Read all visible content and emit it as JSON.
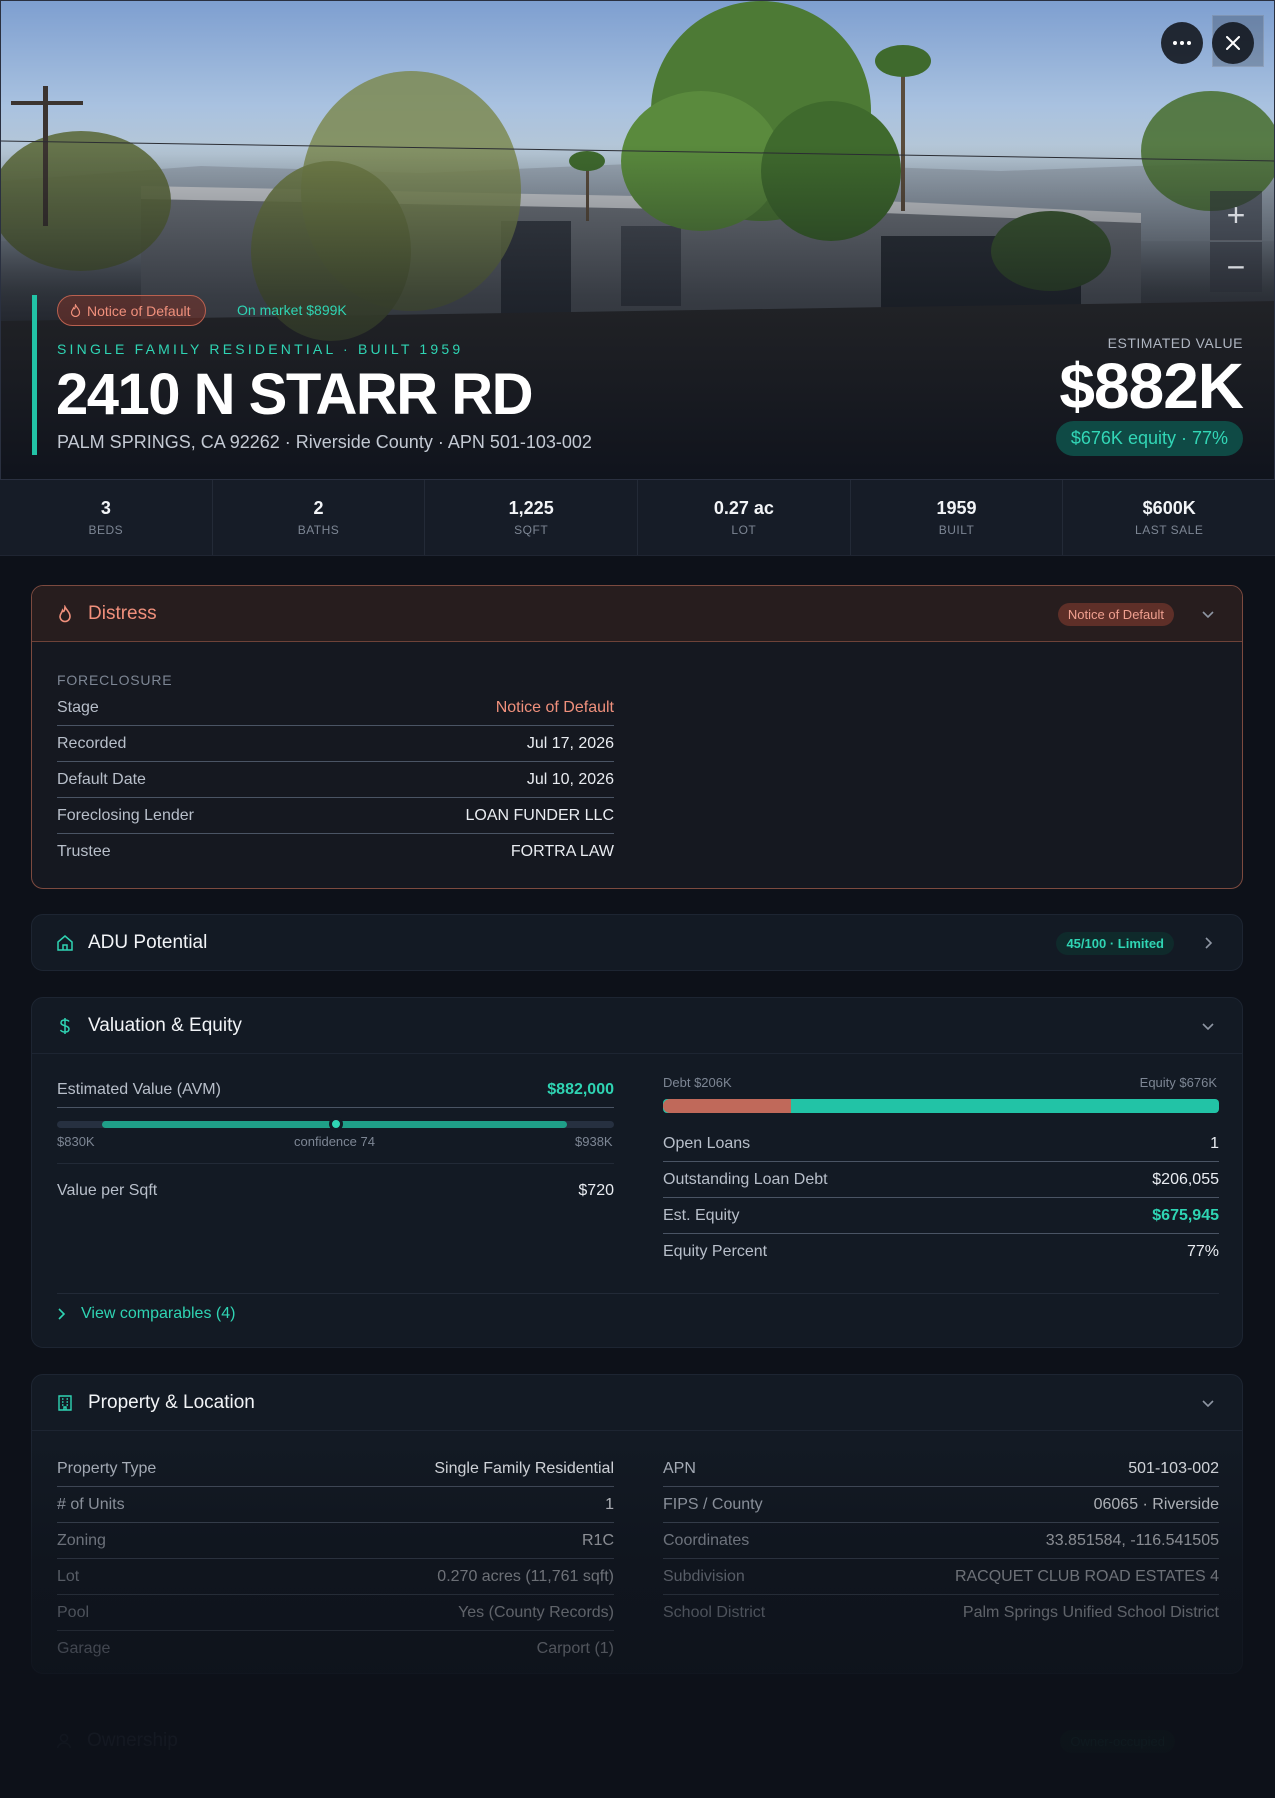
{
  "hero": {
    "distress_badge": "Notice of Default",
    "on_market": "On market $899K",
    "subtitle": "SINGLE FAMILY RESIDENTIAL · BUILT 1959",
    "address": "2410 N STARR RD",
    "sub_address": "PALM SPRINGS, CA 92262 · Riverside County · APN 501-103-002",
    "estimated_label": "ESTIMATED VALUE",
    "estimated_value": "$882K",
    "equity_pill": "$676K equity · 77%",
    "controls": {
      "more_icon": "more-horizontal-icon",
      "close_icon": "close-icon",
      "zoom_in": "+",
      "zoom_out": "−"
    }
  },
  "stats": [
    {
      "value": "3",
      "label": "BEDS"
    },
    {
      "value": "2",
      "label": "BATHS"
    },
    {
      "value": "1,225",
      "label": "SQFT"
    },
    {
      "value": "0.27 ac",
      "label": "LOT"
    },
    {
      "value": "1959",
      "label": "BUILT"
    },
    {
      "value": "$600K",
      "label": "LAST SALE"
    }
  ],
  "distress": {
    "title": "Distress",
    "tag": "Notice of Default",
    "section": "FORECLOSURE",
    "rows": [
      {
        "k": "Stage",
        "v": "Notice of Default"
      },
      {
        "k": "Recorded",
        "v": "Jul 17, 2026"
      },
      {
        "k": "Default Date",
        "v": "Jul 10, 2026"
      },
      {
        "k": "Foreclosing Lender",
        "v": "LOAN FUNDER LLC"
      },
      {
        "k": "Trustee",
        "v": "FORTRA LAW"
      }
    ]
  },
  "adu": {
    "title": "ADU Potential",
    "tag": "45/100 · Limited"
  },
  "valuation": {
    "title": "Valuation & Equity",
    "avm_label": "Estimated Value (AVM)",
    "avm_value": "$882,000",
    "range_low": "$830K",
    "range_mid": "confidence 74",
    "range_high": "$938K",
    "confidence_marker_fraction": 0.5,
    "value_per_sqft_label": "Value per Sqft",
    "value_per_sqft": "$720",
    "debt_label": "Debt $206K",
    "equity_label": "Equity $676K",
    "debt_fraction": 0.23,
    "loan_rows": [
      {
        "k": "Open Loans",
        "v": "1"
      },
      {
        "k": "Outstanding Loan Debt",
        "v": "$206,055"
      },
      {
        "k": "Est. Equity",
        "v": "$675,945"
      },
      {
        "k": "Equity Percent",
        "v": "77%"
      }
    ],
    "comparables": "View comparables (4)"
  },
  "property": {
    "title": "Property & Location",
    "left_rows": [
      {
        "k": "Property Type",
        "v": "Single Family Residential"
      },
      {
        "k": "# of Units",
        "v": "1"
      },
      {
        "k": "Zoning",
        "v": "R1C"
      },
      {
        "k": "Lot",
        "v": "0.270 acres (11,761 sqft)"
      },
      {
        "k": "Pool",
        "v": "Yes (County Records)"
      },
      {
        "k": "Garage",
        "v": "Carport (1)"
      }
    ],
    "right_rows": [
      {
        "k": "APN",
        "v": "501-103-002"
      },
      {
        "k": "FIPS / County",
        "v": "06065 · Riverside"
      },
      {
        "k": "Coordinates",
        "v": "33.851584, -116.541505"
      },
      {
        "k": "Subdivision",
        "v": "RACQUET CLUB ROAD ESTATES 4"
      },
      {
        "k": "School District",
        "v": "Palm Springs Unified School District"
      }
    ]
  },
  "ownership": {
    "title": "Ownership",
    "tag": "Owner-occupied"
  },
  "colors": {
    "accent": "#22c3a6",
    "distress": "#f0907c",
    "debt_bar": "#c0695a",
    "background": "#0d1119"
  }
}
